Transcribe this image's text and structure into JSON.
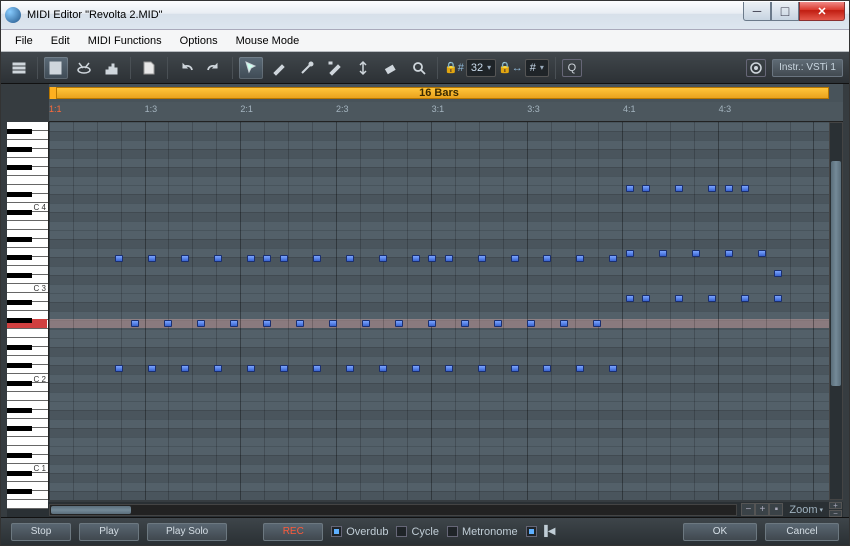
{
  "window": {
    "title": "MIDI Editor \"Revolta 2.MID\""
  },
  "menu": [
    "File",
    "Edit",
    "MIDI Functions",
    "Options",
    "Mouse Mode"
  ],
  "toolbar": {
    "snap_value": "32",
    "length_value": "#",
    "instrument_label": "Instr.: VSTi 1"
  },
  "timeline": {
    "loop_label": "16 Bars",
    "ticks": [
      {
        "pos": 0,
        "label": "1:1",
        "major": true
      },
      {
        "pos": 12.05,
        "label": "1:3"
      },
      {
        "pos": 24.1,
        "label": "2:1"
      },
      {
        "pos": 36.14,
        "label": "2:3"
      },
      {
        "pos": 48.19,
        "label": "3:1"
      },
      {
        "pos": 60.24,
        "label": "3:3"
      },
      {
        "pos": 72.29,
        "label": "4:1"
      },
      {
        "pos": 84.34,
        "label": "4:3"
      }
    ]
  },
  "piano": {
    "octaves": [
      "C1",
      "C2",
      "C3",
      "C4"
    ]
  },
  "zoom": {
    "label": "Zoom"
  },
  "bottom": {
    "stop": "Stop",
    "play": "Play",
    "playsolo": "Play Solo",
    "rec": "REC",
    "overdub": "Overdub",
    "cycle": "Cycle",
    "metronome": "Metronome",
    "ok": "OK",
    "cancel": "Cancel"
  },
  "notes": [
    {
      "b": 4,
      "r": 0
    },
    {
      "b": 4,
      "r": 2
    },
    {
      "b": 5,
      "r": 1
    },
    {
      "b": 6,
      "r": 0
    },
    {
      "b": 6,
      "r": 2
    },
    {
      "b": 7,
      "r": 1
    },
    {
      "b": 8,
      "r": 0
    },
    {
      "b": 8,
      "r": 2
    },
    {
      "b": 9,
      "r": 1
    },
    {
      "b": 10,
      "r": 0
    },
    {
      "b": 10,
      "r": 2
    },
    {
      "b": 11,
      "r": 1
    },
    {
      "b": 12,
      "r": 0
    },
    {
      "b": 12,
      "r": 2
    },
    {
      "b": 13,
      "r": 0
    },
    {
      "b": 13,
      "r": 1
    },
    {
      "b": 14,
      "r": 0
    },
    {
      "b": 14,
      "r": 2
    },
    {
      "b": 15,
      "r": 1
    },
    {
      "b": 16,
      "r": 0
    },
    {
      "b": 16,
      "r": 2
    },
    {
      "b": 17,
      "r": 1
    },
    {
      "b": 18,
      "r": 0
    },
    {
      "b": 18,
      "r": 2
    },
    {
      "b": 19,
      "r": 1
    },
    {
      "b": 20,
      "r": 0
    },
    {
      "b": 20,
      "r": 2
    },
    {
      "b": 21,
      "r": 1
    },
    {
      "b": 22,
      "r": 0
    },
    {
      "b": 22,
      "r": 2
    },
    {
      "b": 23,
      "r": 0
    },
    {
      "b": 23,
      "r": 1
    },
    {
      "b": 24,
      "r": 0
    },
    {
      "b": 24,
      "r": 2
    },
    {
      "b": 25,
      "r": 1
    },
    {
      "b": 26,
      "r": 0
    },
    {
      "b": 26,
      "r": 2
    },
    {
      "b": 27,
      "r": 1
    },
    {
      "b": 28,
      "r": 0
    },
    {
      "b": 28,
      "r": 2
    },
    {
      "b": 29,
      "r": 1
    },
    {
      "b": 30,
      "r": 0
    },
    {
      "b": 30,
      "r": 2
    },
    {
      "b": 31,
      "r": 1
    },
    {
      "b": 32,
      "r": 0
    },
    {
      "b": 32,
      "r": 2
    },
    {
      "b": 33,
      "r": 1
    },
    {
      "b": 34,
      "r": 0
    },
    {
      "b": 34,
      "r": 2
    },
    {
      "b": 35,
      "r": 0,
      "ro": -70
    },
    {
      "b": 35,
      "r": 1,
      "ro": -70
    },
    {
      "b": 35,
      "r": 2,
      "ro": -70
    },
    {
      "b": 36,
      "r": 0,
      "ro": -70
    },
    {
      "b": 36,
      "r": 2,
      "ro": -70
    },
    {
      "b": 37,
      "r": 1,
      "ro": -70
    },
    {
      "b": 38,
      "r": 0,
      "ro": -70
    },
    {
      "b": 38,
      "r": 2,
      "ro": -70
    },
    {
      "b": 39,
      "r": 1,
      "ro": -70
    },
    {
      "b": 40,
      "r": 0,
      "ro": -70
    },
    {
      "b": 40,
      "r": 2,
      "ro": -70
    },
    {
      "b": 41,
      "r": 0,
      "ro": -70
    },
    {
      "b": 41,
      "r": 1,
      "ro": -70
    },
    {
      "b": 42,
      "r": 0,
      "ro": -70
    },
    {
      "b": 42,
      "r": 2,
      "ro": -70
    },
    {
      "b": 43,
      "r": 1,
      "ro": -70
    },
    {
      "b": 44,
      "r": 0,
      "ro": 15
    },
    {
      "b": 44,
      "r": 2,
      "ro": -70
    }
  ],
  "note_rows": {
    "0": 133,
    "1": 198,
    "2": 243
  }
}
